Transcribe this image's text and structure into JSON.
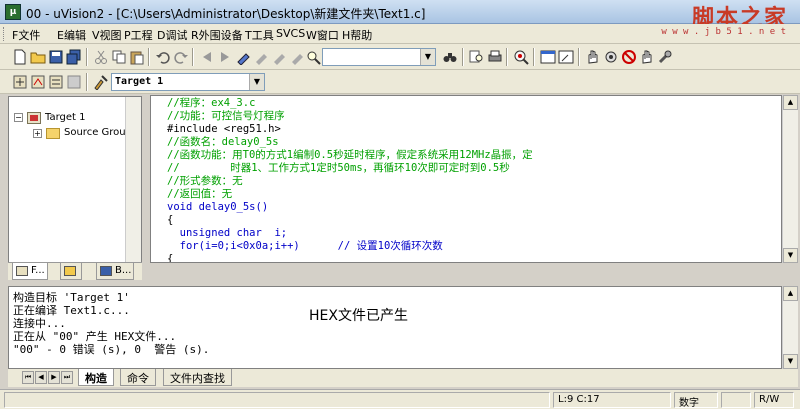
{
  "titlebar": {
    "title": "00 - uVision2 - [C:\\Users\\Administrator\\Desktop\\新建文件夹\\Text1.c]",
    "watermark": "脚本之家",
    "watermark_url": "w w w . j b 5 1 . n e t"
  },
  "menu": {
    "items": [
      "F文件",
      "E编辑",
      "V视图",
      "P工程",
      "D调试",
      "R外围设备",
      "T工具",
      "SVCS",
      "W窗口",
      "H帮助"
    ]
  },
  "toolbar2": {
    "target_select": "Target 1"
  },
  "project": {
    "target_label": "Target 1",
    "group_label": "Source Group 1",
    "tabs": [
      "F...",
      "",
      "B..."
    ]
  },
  "editor": {
    "lines": [
      {
        "text": "//程序：ex4_3.c",
        "cls": "c-comment"
      },
      {
        "text": "//功能：可控信号灯程序",
        "cls": "c-comment"
      },
      {
        "text": "#include <reg51.h>",
        "cls": "c-kw"
      },
      {
        "text": "//函数名：delay0_5s",
        "cls": "c-comment"
      },
      {
        "text": "//函数功能：用T0的方式1编制0.5秒延时程序，假定系统采用12MHz晶振，定",
        "cls": "c-comment"
      },
      {
        "text": "//        时器1、工作方式1定时50ms，再循环10次即可定时到0.5秒",
        "cls": "c-comment"
      },
      {
        "text": "//形式参数：无",
        "cls": "c-comment"
      },
      {
        "text": "//返回值：无",
        "cls": "c-comment"
      },
      {
        "text": "void delay0_5s()",
        "cls": "c-plain"
      },
      {
        "text": "{",
        "cls": "c-plain"
      },
      {
        "text": "  unsigned char  i;",
        "cls": "c-plain"
      },
      {
        "text": "  for(i=0;i<0x0a;i++)      // 设置10次循环次数",
        "cls": "c-plain"
      },
      {
        "text": "{",
        "cls": "c-plain"
      }
    ]
  },
  "output": {
    "lines": [
      "构造目标 'Target 1'",
      "正在编译 Text1.c...",
      "连接中...",
      "正在从 \"00\" 产生 HEX文件...",
      "\"00\" - 0 错误 (s), 0  警告 (s)."
    ],
    "overlay": "HEX文件已产生",
    "tabs": [
      "构造",
      "命令",
      "文件内查找"
    ]
  },
  "status": {
    "position": "L:9 C:17",
    "caps": "数字",
    "mode": "R/W"
  }
}
